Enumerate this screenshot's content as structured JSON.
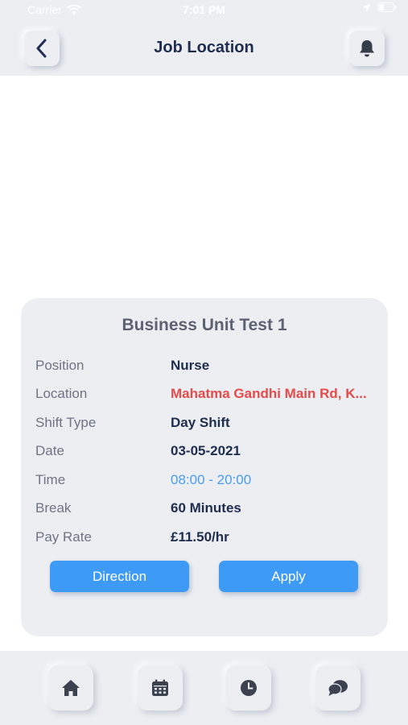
{
  "status_bar": {
    "carrier": "Carrier",
    "time": "7:01 PM"
  },
  "header": {
    "title": "Job Location",
    "back_icon": "chevron-left-icon",
    "notification_icon": "bell-icon"
  },
  "job_card": {
    "title": "Business Unit Test 1",
    "position": {
      "label": "Position",
      "value": "Nurse"
    },
    "location": {
      "label": "Location",
      "value": "Mahatma Gandhi Main Rd, K..."
    },
    "shift_type": {
      "label": "Shift Type",
      "value": "Day Shift"
    },
    "date": {
      "label": "Date",
      "value": "03-05-2021"
    },
    "time": {
      "label": "Time",
      "value": "08:00 - 20:00"
    },
    "break": {
      "label": "Break",
      "value": "60 Minutes"
    },
    "pay_rate": {
      "label": "Pay Rate",
      "value": "£11.50/hr"
    },
    "direction_label": "Direction",
    "apply_label": "Apply"
  },
  "bottom_nav": {
    "items": [
      "home-icon",
      "calendar-icon",
      "clock-icon",
      "chat-icon"
    ]
  },
  "colors": {
    "accent": "#3d9bf5",
    "title_text": "#1f2d4e",
    "location_text": "#e54b4b",
    "time_text": "#4a9cf0",
    "panel_bg": "#eceef2"
  }
}
